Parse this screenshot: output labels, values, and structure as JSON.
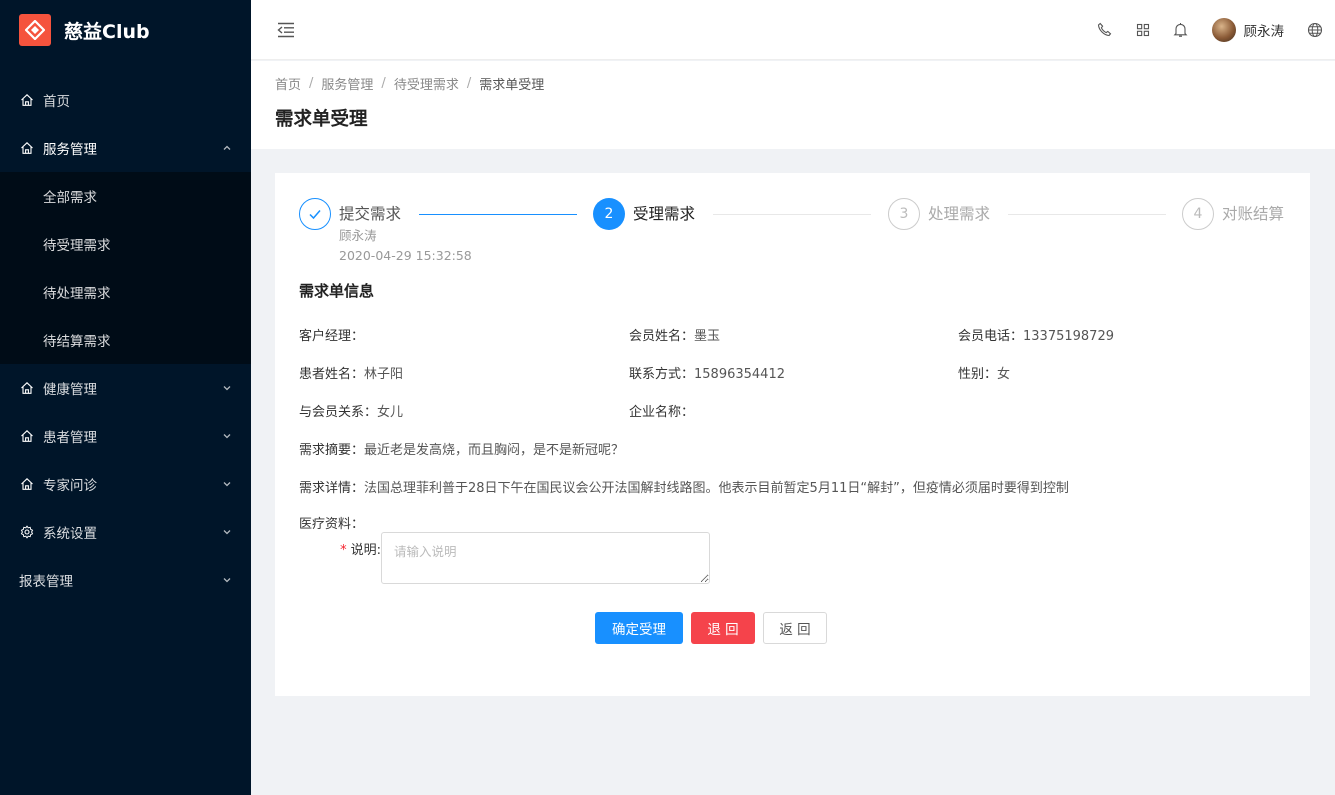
{
  "app": {
    "name": "慈益Club",
    "accent": "#1890ff",
    "logo_color": "#f5533d"
  },
  "sidebar": {
    "items": [
      {
        "label": "首页",
        "icon": "home-icon"
      },
      {
        "label": "服务管理",
        "icon": "home-icon",
        "open": true,
        "children": [
          "全部需求",
          "待受理需求",
          "待处理需求",
          "待结算需求"
        ]
      },
      {
        "label": "健康管理",
        "icon": "home-icon"
      },
      {
        "label": "患者管理",
        "icon": "home-icon"
      },
      {
        "label": "专家问诊",
        "icon": "home-icon"
      },
      {
        "label": "系统设置",
        "icon": "gear-icon"
      },
      {
        "label": "报表管理",
        "icon": ""
      }
    ]
  },
  "header": {
    "username": "顾永涛"
  },
  "breadcrumb": [
    "首页",
    "服务管理",
    "待受理需求",
    "需求单受理"
  ],
  "page_title": "需求单受理",
  "steps": [
    {
      "num": "✓",
      "title": "提交需求",
      "desc1": "顾永涛",
      "desc2": "2020-04-29 15:32:58",
      "status": "done"
    },
    {
      "num": "2",
      "title": "受理需求",
      "status": "active"
    },
    {
      "num": "3",
      "title": "处理需求",
      "status": "wait"
    },
    {
      "num": "4",
      "title": "对账结算",
      "status": "wait"
    }
  ],
  "section_title": "需求单信息",
  "info": {
    "manager_label": "客户经理：",
    "manager_value": "",
    "member_name_label": "会员姓名：",
    "member_name_value": "墨玉",
    "member_phone_label": "会员电话：",
    "member_phone_value": "13375198729",
    "patient_label": "患者姓名：",
    "patient_value": "林子阳",
    "contact_label": "联系方式：",
    "contact_value": "15896354412",
    "gender_label": "性别：",
    "gender_value": "女",
    "relation_label": "与会员关系：",
    "relation_value": "女儿",
    "company_label": "企业名称：",
    "company_value": "",
    "summary_label": "需求摘要：",
    "summary_value": "最近老是发高烧，而且胸闷，是不是新冠呢？",
    "detail_label": "需求详情：",
    "detail_value": "法国总理菲利普于28日下午在国民议会公开法国解封线路图。他表示目前暂定5月11日“解封”，但疫情必须届时要得到控制"
  },
  "form": {
    "medical_label": "医疗资料：",
    "desc_required": "*",
    "desc_label": "说明:",
    "desc_placeholder": "请输入说明"
  },
  "buttons": {
    "confirm": "确定受理",
    "reject": "退 回",
    "back": "返 回"
  }
}
